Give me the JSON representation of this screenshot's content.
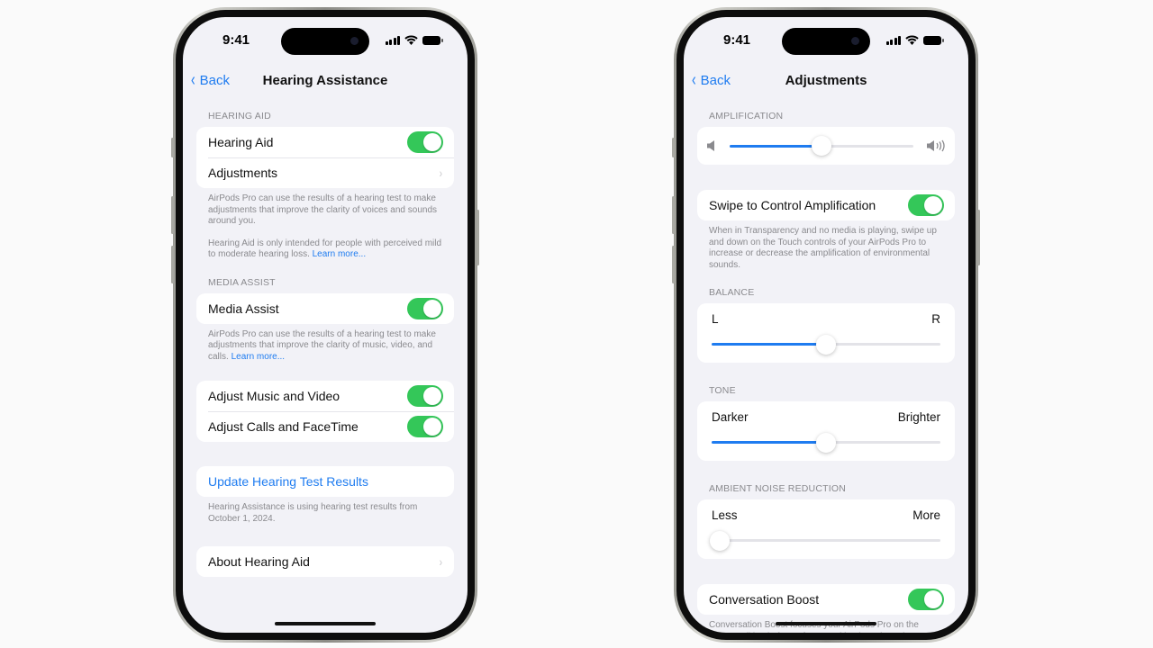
{
  "status_bar": {
    "time": "9:41"
  },
  "left_screen": {
    "nav": {
      "back_label": "Back",
      "title": "Hearing Assistance"
    },
    "hearing_aid_section": {
      "header": "HEARING AID",
      "rows": [
        {
          "label": "Hearing Aid",
          "control": "toggle",
          "on": true
        },
        {
          "label": "Adjustments",
          "control": "chevron"
        }
      ],
      "footer_p1": "AirPods Pro can use the results of a hearing test to make adjustments that improve the clarity of voices and sounds around you.",
      "footer_p2": "Hearing Aid is only intended for people with perceived mild to moderate hearing loss.",
      "footer_link": "Learn more..."
    },
    "media_assist_section": {
      "header": "MEDIA ASSIST",
      "rows": [
        {
          "label": "Media Assist",
          "control": "toggle",
          "on": true
        }
      ],
      "footer": "AirPods Pro can use the results of a hearing test to make adjustments that improve the clarity of music, video, and calls.",
      "footer_link": "Learn more..."
    },
    "adjust_section": {
      "rows": [
        {
          "label": "Adjust Music and Video",
          "control": "toggle",
          "on": true
        },
        {
          "label": "Adjust Calls and FaceTime",
          "control": "toggle",
          "on": true
        }
      ]
    },
    "update_section": {
      "link_label": "Update Hearing Test Results",
      "footer": "Hearing Assistance is using hearing test results from October 1, 2024."
    },
    "about_section": {
      "label": "About Hearing Aid"
    }
  },
  "right_screen": {
    "nav": {
      "back_label": "Back",
      "title": "Adjustments"
    },
    "amplification": {
      "header": "AMPLIFICATION",
      "value_percent": 50,
      "min_icon": "speaker-low-icon",
      "max_icon": "speaker-high-icon"
    },
    "swipe_control": {
      "label": "Swipe to Control Amplification",
      "on": true,
      "footer": "When in Transparency and no media is playing, swipe up and down on the Touch controls of your AirPods Pro to increase or decrease the amplification of environmental sounds."
    },
    "balance": {
      "header": "BALANCE",
      "left_label": "L",
      "right_label": "R",
      "value_percent": 50
    },
    "tone": {
      "header": "TONE",
      "left_label": "Darker",
      "right_label": "Brighter",
      "value_percent": 50
    },
    "ambient_noise": {
      "header": "AMBIENT NOISE REDUCTION",
      "left_label": "Less",
      "right_label": "More",
      "value_percent": 0
    },
    "conversation_boost": {
      "label": "Conversation Boost",
      "on": true,
      "footer": "Conversation Boost focuses your AirPods Pro on the person talking in front of you, making it easier to hear."
    }
  },
  "colors": {
    "accent": "#1f7cf0",
    "toggle_on": "#34c759",
    "background": "#f2f2f7"
  }
}
